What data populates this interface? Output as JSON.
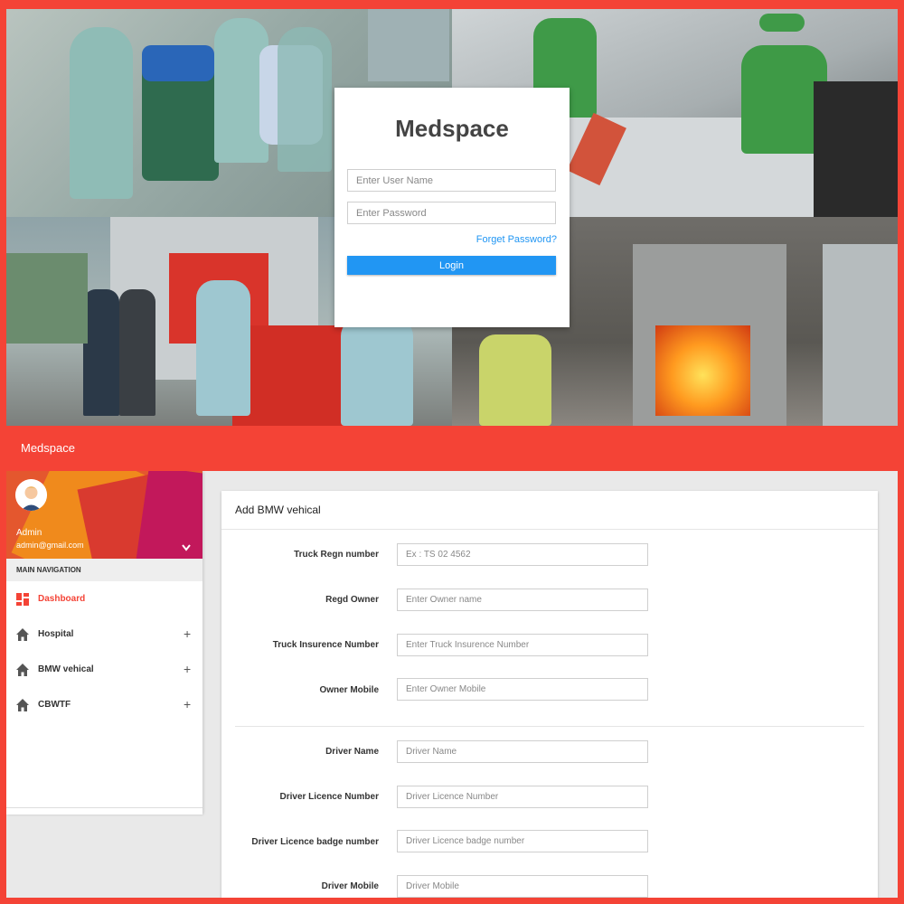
{
  "login": {
    "title": "Medspace",
    "username_placeholder": "Enter User Name",
    "password_placeholder": "Enter Password",
    "forgot_label": "Forget Password?",
    "login_label": "Login"
  },
  "topbar": {
    "brand": "Medspace"
  },
  "sidebar": {
    "user_name": "Admin",
    "user_email": "admin@gmail.com",
    "nav_header": "MAIN NAVIGATION",
    "items": [
      {
        "label": "Dashboard",
        "icon": "dashboard-icon",
        "active": true
      },
      {
        "label": "Hospital",
        "icon": "home-icon",
        "expand": "+"
      },
      {
        "label": "BMW vehical",
        "icon": "home-icon",
        "expand": "+"
      },
      {
        "label": "CBWTF",
        "icon": "home-icon",
        "expand": "+"
      }
    ]
  },
  "form": {
    "title": "Add BMW vehical",
    "fields": [
      {
        "label": "Truck Regn number",
        "placeholder": "Ex : TS 02 4562"
      },
      {
        "label": "Regd Owner",
        "placeholder": "Enter Owner name"
      },
      {
        "label": "Truck Insurence Number",
        "placeholder": "Enter Truck Insurence Number"
      },
      {
        "label": "Owner Mobile",
        "placeholder": "Enter Owner Mobile"
      },
      {
        "label": "Driver Name",
        "placeholder": "Driver Name"
      },
      {
        "label": "Driver Licence Number",
        "placeholder": "Driver Licence Number"
      },
      {
        "label": "Driver Licence badge number",
        "placeholder": "Driver Licence badge number"
      },
      {
        "label": "Driver Mobile",
        "placeholder": "Driver Mobile"
      }
    ]
  },
  "colors": {
    "primary_red": "#f44336",
    "accent_blue": "#2196f3",
    "panel_grey": "#e9e9e9"
  }
}
